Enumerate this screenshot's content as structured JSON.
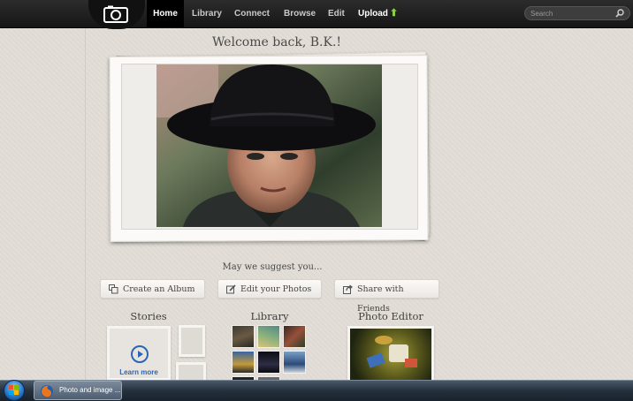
{
  "nav": {
    "items": [
      {
        "label": "Home",
        "active": true
      },
      {
        "label": "Library"
      },
      {
        "label": "Connect"
      },
      {
        "label": "Browse"
      },
      {
        "label": "Edit"
      },
      {
        "label": "Upload"
      }
    ],
    "search_placeholder": "Search",
    "logo_icon": "camera-icon",
    "upload_icon": "upload-arrow-icon",
    "accent_color": "#8bd23c"
  },
  "welcome": {
    "title": "Welcome back, B.K.!"
  },
  "hero": {
    "photo": "boy-in-black-hat"
  },
  "suggest": {
    "heading": "May we suggest you...",
    "buttons": [
      {
        "label": "Create an Album",
        "icon": "album-icon"
      },
      {
        "label": "Edit your Photos",
        "icon": "edit-icon"
      },
      {
        "label": "Share with Friends",
        "icon": "share-icon"
      }
    ]
  },
  "sections": {
    "stories": {
      "title": "Stories",
      "learn_more": "Learn more",
      "icon": "play-icon",
      "link_color": "#2b66b4"
    },
    "library": {
      "title": "Library"
    },
    "editor": {
      "title": "Photo Editor"
    }
  },
  "taskbar": {
    "start_icon": "windows-start-icon",
    "items": [
      {
        "label": "Photo and image ...",
        "icon": "firefox-icon"
      }
    ]
  }
}
